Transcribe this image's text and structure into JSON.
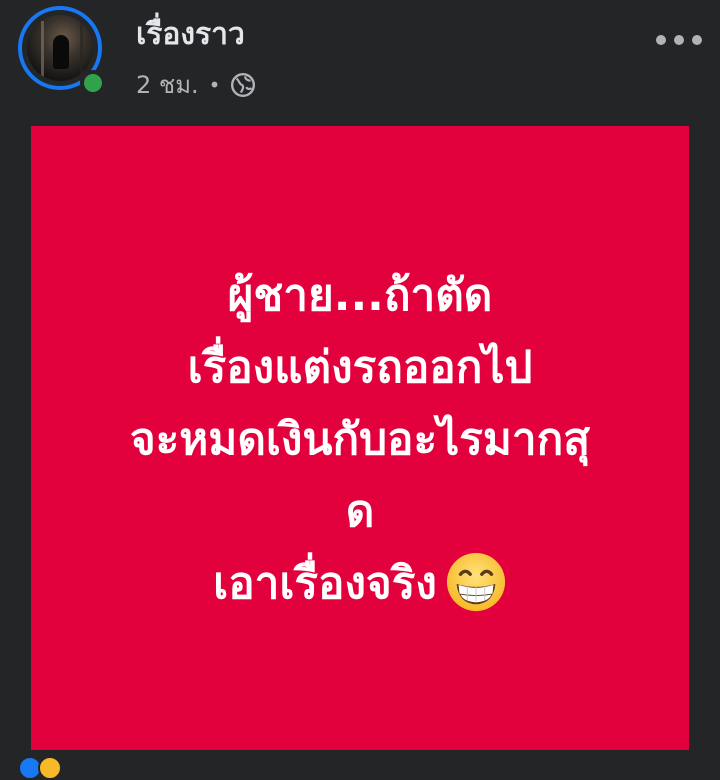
{
  "post": {
    "author": "เรื่องราว",
    "time": "2 ชม.",
    "separator": "•",
    "privacy_icon": "globe-icon",
    "more_icon": "more-options-icon"
  },
  "image": {
    "background_color": "#e2003d",
    "lines": [
      "ผู้ชาย...ถ้าตัด",
      "เรื่องแต่งรถออกไป",
      "จะหมดเงินกับอะไรมากสุ",
      "ด",
      "เอาเรื่องจริง"
    ],
    "emoji": "grinning-face-emoji"
  },
  "colors": {
    "accent": "#1877f2",
    "online": "#31a24c",
    "background": "#242526"
  }
}
